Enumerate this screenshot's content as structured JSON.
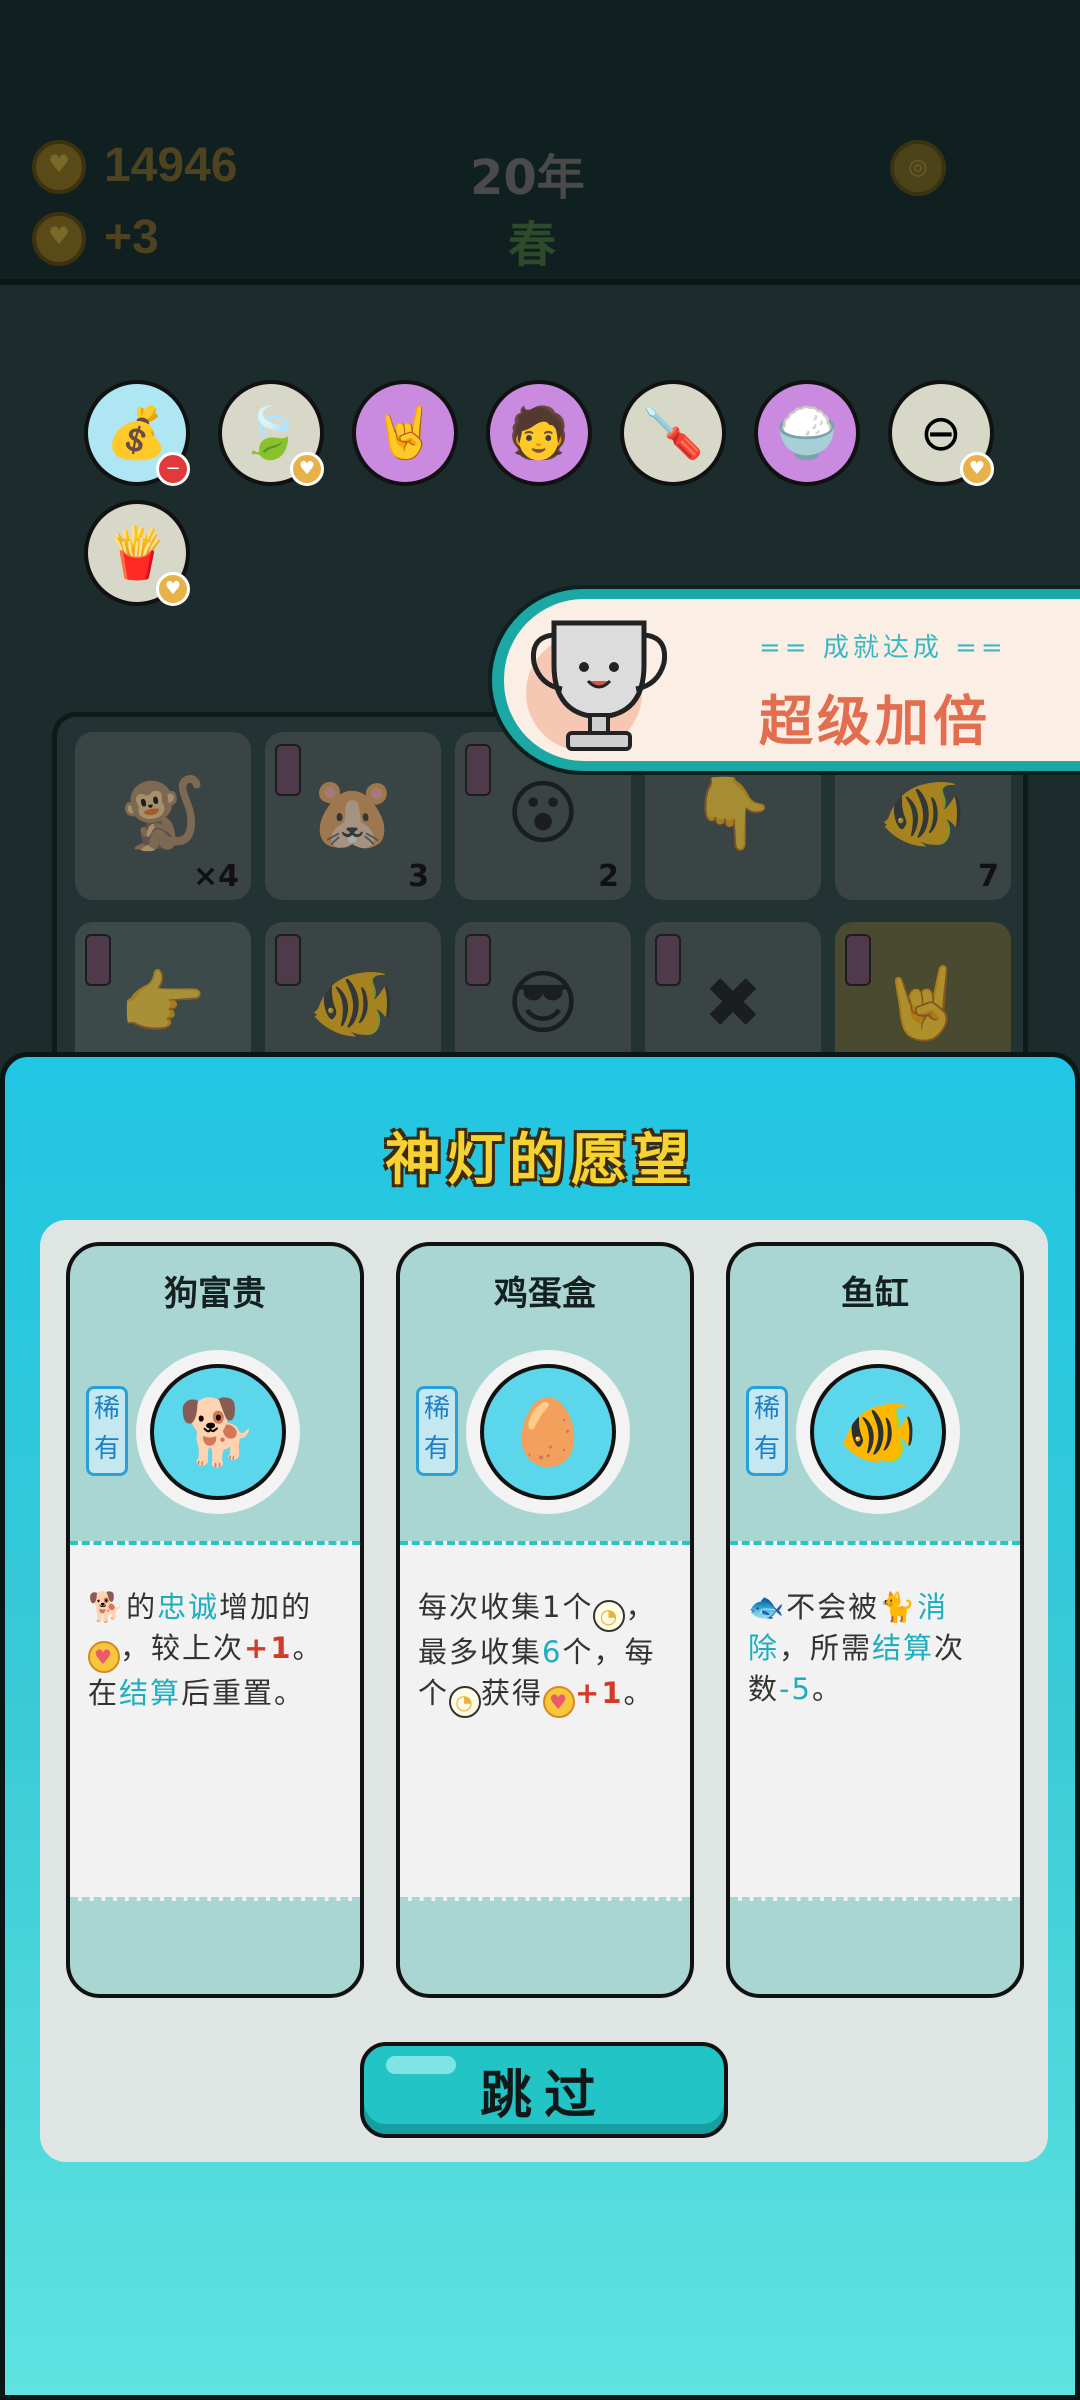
{
  "topbar": {
    "gold": "14946",
    "income": "+3",
    "year": "20年",
    "season": "春",
    "menu_icon": "menu-coin-icon"
  },
  "items": [
    {
      "name": "money-bag-icon",
      "glyph": "💰",
      "bg": "#aee6f4",
      "badge": "minus"
    },
    {
      "name": "leaf-icon",
      "glyph": "🍃",
      "bg": "#d8d8c8",
      "badge": "coin"
    },
    {
      "name": "rock-hand-icon",
      "glyph": "🤘",
      "bg": "#c98ae0",
      "badge": ""
    },
    {
      "name": "multiplier-head-icon",
      "glyph": "🧑",
      "bg": "#c98ae0",
      "badge": ""
    },
    {
      "name": "screwdriver-icon",
      "glyph": "🪛",
      "bg": "#d8d8c8",
      "badge": ""
    },
    {
      "name": "rice-bowls-icon",
      "glyph": "🍚",
      "bg": "#c98ae0",
      "badge": ""
    },
    {
      "name": "minus-circle-icon",
      "glyph": "⊖",
      "bg": "#d8d8c8",
      "badge": "coin"
    },
    {
      "name": "fries-icon",
      "glyph": "🍟",
      "bg": "#d8d8c8",
      "badge": "coin"
    }
  ],
  "board": {
    "counts": [
      "×4",
      "3",
      "2",
      "",
      "7"
    ]
  },
  "achievement": {
    "subtitle": "== 成就达成 ==",
    "title": "超级加倍"
  },
  "wish": {
    "title": "神灯的愿望",
    "skip_label": "跳过",
    "cards": [
      {
        "name": "狗富贵",
        "rarity": "稀有",
        "icon": "rich-dog-icon",
        "desc": [
          {
            "t": "🐕",
            "c": "icon"
          },
          {
            "t": "的",
            "c": ""
          },
          {
            "t": "忠诚",
            "c": "hl"
          },
          {
            "t": "增加的",
            "c": ""
          },
          {
            "t": "♥",
            "c": "heart"
          },
          {
            "t": "，较上次",
            "c": ""
          },
          {
            "t": "+1",
            "c": "plus"
          },
          {
            "t": "。",
            "c": ""
          },
          {
            "t": "在",
            "c": "br"
          },
          {
            "t": "结算",
            "c": "hl"
          },
          {
            "t": "后重置。",
            "c": ""
          }
        ]
      },
      {
        "name": "鸡蛋盒",
        "rarity": "稀有",
        "icon": "egg-box-icon",
        "desc": [
          {
            "t": "每次收集1个",
            "c": ""
          },
          {
            "t": "◔",
            "c": "egg"
          },
          {
            "t": "，最多收集",
            "c": ""
          },
          {
            "t": "6",
            "c": "hl"
          },
          {
            "t": "个，每个",
            "c": ""
          },
          {
            "t": "◔",
            "c": "egg"
          },
          {
            "t": "获得",
            "c": ""
          },
          {
            "t": "♥",
            "c": "heart"
          },
          {
            "t": "+1",
            "c": "plus"
          },
          {
            "t": "。",
            "c": ""
          }
        ]
      },
      {
        "name": "鱼缸",
        "rarity": "稀有",
        "icon": "fish-tank-icon",
        "desc": [
          {
            "t": "🐟",
            "c": "icon"
          },
          {
            "t": "不会被",
            "c": ""
          },
          {
            "t": "🐈",
            "c": "icon"
          },
          {
            "t": "消除",
            "c": "hl"
          },
          {
            "t": "，所需",
            "c": ""
          },
          {
            "t": "结算",
            "c": "hl"
          },
          {
            "t": "次数",
            "c": ""
          },
          {
            "t": "-5",
            "c": "hl"
          },
          {
            "t": "。",
            "c": ""
          }
        ]
      }
    ]
  }
}
